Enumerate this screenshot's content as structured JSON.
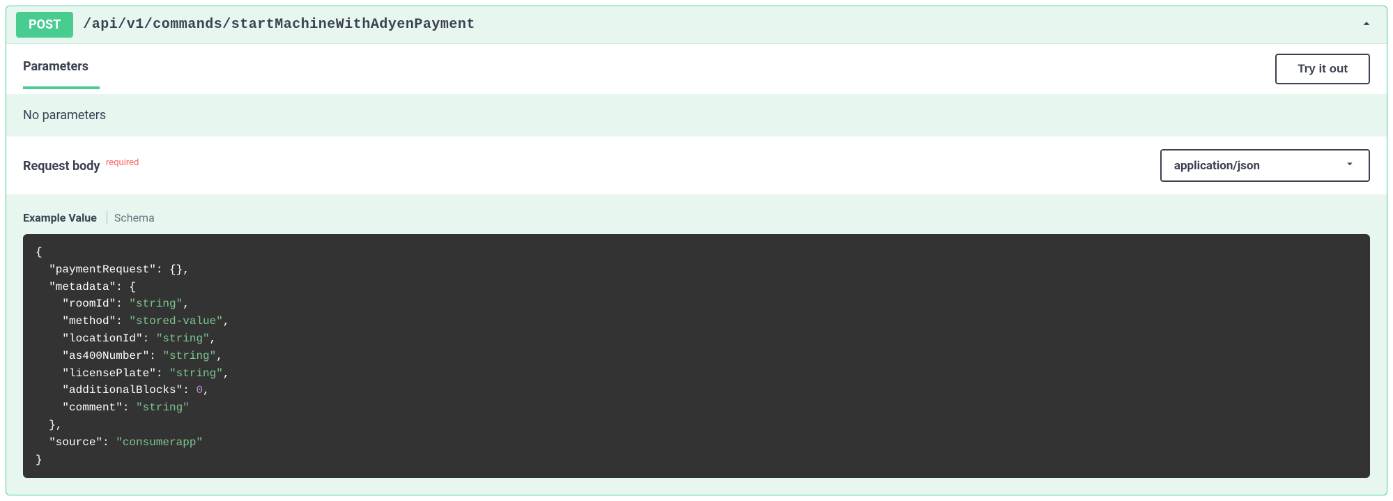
{
  "method": "POST",
  "path": "/api/v1/commands/startMachineWithAdyenPayment",
  "parameters": {
    "title": "Parameters",
    "tryItOut": "Try it out",
    "emptyText": "No parameters"
  },
  "requestBody": {
    "title": "Request body",
    "requiredLabel": "required",
    "contentType": "application/json",
    "tabs": {
      "example": "Example Value",
      "schema": "Schema"
    },
    "example": {
      "paymentRequest": {},
      "metadata": {
        "roomId": "string",
        "method": "stored-value",
        "locationId": "string",
        "as400Number": "string",
        "licensePlate": "string",
        "additionalBlocks": 0,
        "comment": "string"
      },
      "source": "consumerapp"
    }
  }
}
